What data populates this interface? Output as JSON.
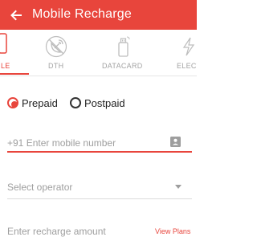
{
  "appbar": {
    "title": "Mobile Recharge",
    "color": "#e8453c"
  },
  "tabs": [
    {
      "label": "LE",
      "icon": "mobile-phone-icon",
      "active": true
    },
    {
      "label": "DTH",
      "icon": "satellite-dish-icon",
      "active": false
    },
    {
      "label": "DATACARD",
      "icon": "data-card-icon",
      "active": false
    },
    {
      "label": "ELECT",
      "icon": "electricity-icon",
      "active": false
    }
  ],
  "recharge_type": {
    "options": [
      {
        "label": "Prepaid",
        "selected": true
      },
      {
        "label": "Postpaid",
        "selected": false
      }
    ]
  },
  "mobile_number": {
    "placeholder": "+91 Enter mobile number",
    "icon": "contact-book-icon"
  },
  "operator": {
    "placeholder": "Select operator",
    "icon": "dropdown-arrow-icon"
  },
  "amount": {
    "placeholder": "Enter recharge amount",
    "link_label": "View Plans"
  }
}
